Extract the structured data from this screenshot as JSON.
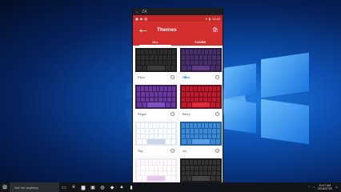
{
  "taskbar": {
    "search_placeholder": "Ask me anything",
    "clock_time": "10:47 AM",
    "clock_date": "2016/07/25"
  },
  "phone": {
    "emulator_title": "ZA",
    "status_time": "12:42",
    "toolbar_title": "Themes",
    "tabs": [
      "ALL",
      "YOURS"
    ],
    "themes": [
      {
        "name": "Pitch",
        "bg": "#1a1a1a",
        "key": "#2d2d2d",
        "accent": "#3a3a3a"
      },
      {
        "name": "Dusk",
        "bg": "#2a1b3d",
        "key": "#4a2f6e",
        "accent": "#5c3a87"
      },
      {
        "name": "Regal",
        "bg": "#3a1f5c",
        "key": "#6a3aa0",
        "accent": "#8052c0"
      },
      {
        "name": "Berry",
        "bg": "#6b0f1a",
        "key": "#c0182c",
        "accent": "#e02a3e"
      },
      {
        "name": "Sky",
        "bg": "#dfe7f2",
        "key": "#ffffff",
        "accent": "#c9d6e8"
      },
      {
        "name": "Ice",
        "bg": "#1e5fa0",
        "key": "#3c8ad6",
        "accent": "#5ba0e6"
      },
      {
        "name": "",
        "bg": "#f2e6f4",
        "key": "#ffffff",
        "accent": "#e8c8ee"
      },
      {
        "name": "",
        "bg": "#1a1a1a",
        "key": "#333333",
        "accent": "#444444"
      }
    ]
  }
}
